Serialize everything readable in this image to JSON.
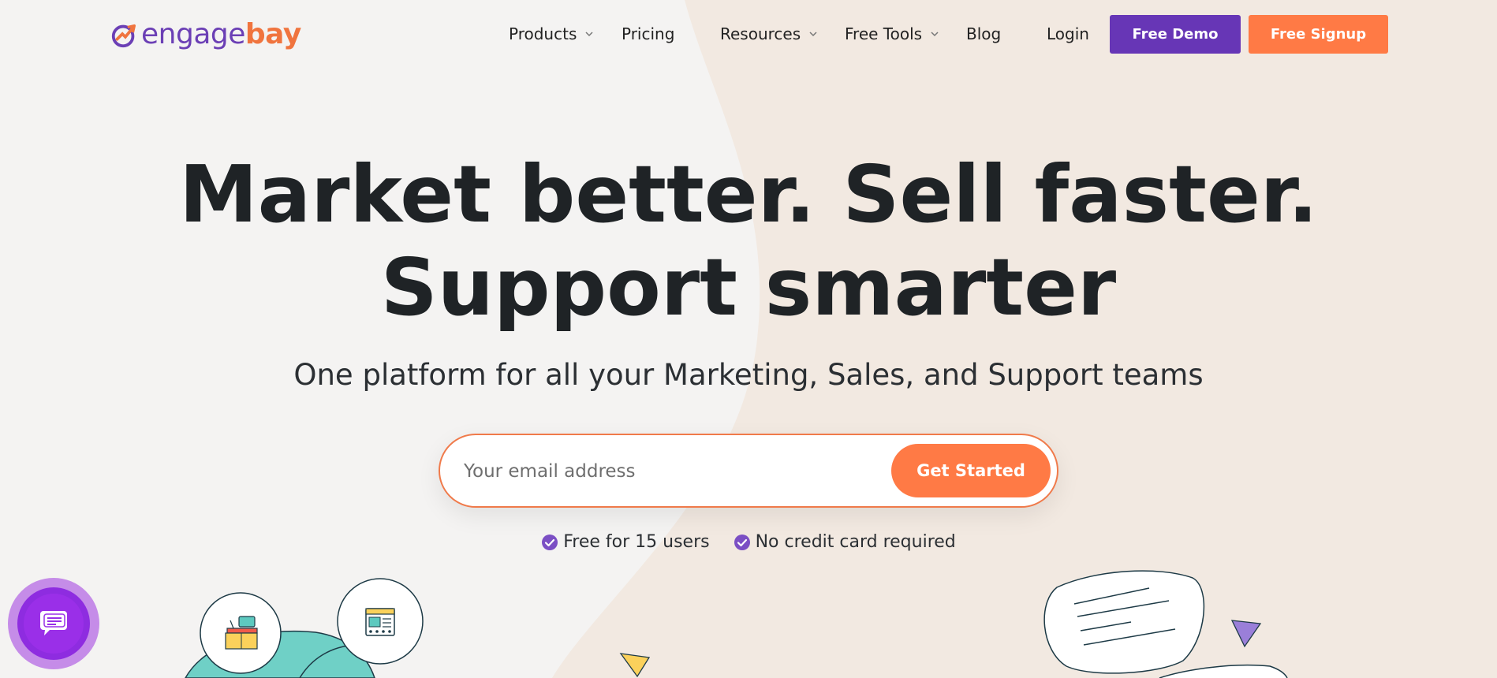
{
  "brand": {
    "name_part1": "engage",
    "name_part2": "bay",
    "colors": {
      "purple": "#6736b6",
      "orange": "#ff7a45",
      "dark_text": "#1f2326"
    }
  },
  "nav": {
    "products": "Products",
    "pricing": "Pricing",
    "resources": "Resources",
    "free_tools": "Free Tools",
    "blog": "Blog",
    "login": "Login",
    "free_demo": "Free Demo",
    "free_signup": "Free Signup"
  },
  "hero": {
    "title_line1": "Market better. Sell faster.",
    "title_line2": "Support smarter",
    "subtitle": "One platform for all your Marketing, Sales, and Support teams"
  },
  "signup": {
    "email_value": "",
    "email_placeholder": "Your email address",
    "button_label": "Get Started"
  },
  "perks": [
    {
      "label": "Free for 15 users",
      "icon": "check-circle-icon"
    },
    {
      "label": "No credit card required",
      "icon": "check-circle-icon"
    }
  ],
  "chat": {
    "icon": "chat-bubble-icon"
  },
  "icons": {
    "logo": "engagebay-logo-icon",
    "chevron": "chevron-down-icon",
    "desk": "desk-computer-icon",
    "browser": "browser-window-icon"
  }
}
